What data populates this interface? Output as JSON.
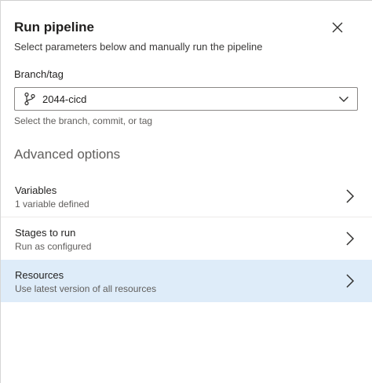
{
  "dialog": {
    "title": "Run pipeline",
    "subtitle": "Select parameters below and manually run the pipeline",
    "close_icon": "close-icon"
  },
  "branch": {
    "label": "Branch/tag",
    "value": "2044-cicd",
    "icon": "git-branch-icon",
    "dropdown_icon": "chevron-down-icon",
    "helper": "Select the branch, commit, or tag"
  },
  "advanced": {
    "title": "Advanced options",
    "items": [
      {
        "title": "Variables",
        "subtitle": "1 variable defined"
      },
      {
        "title": "Stages to run",
        "subtitle": "Run as configured"
      },
      {
        "title": "Resources",
        "subtitle": "Use latest version of all resources"
      }
    ],
    "selected_index": 2,
    "selected_color": "#deecf9"
  }
}
